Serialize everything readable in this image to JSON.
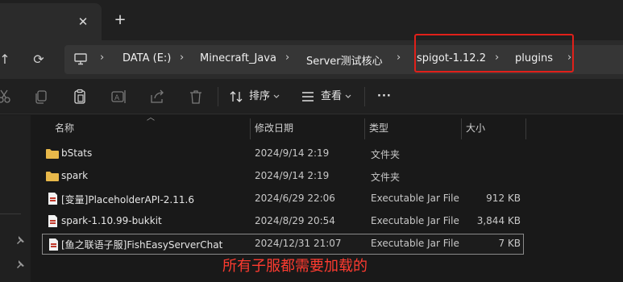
{
  "tabs": {
    "close_glyph": "✕",
    "new_glyph": "+"
  },
  "nav": {
    "up_glyph": "↑",
    "refresh_glyph": "⟳"
  },
  "breadcrumb": {
    "items": [
      "DATA (E:)",
      "Minecraft_Java",
      "Server测试核心",
      "spigot-1.12.2",
      "plugins"
    ],
    "separator": "›"
  },
  "toolbar": {
    "sort_label": "排序",
    "view_label": "查看",
    "more_label": "···",
    "disabled_icon_color": "#7a7a7a"
  },
  "columns": {
    "name": "名称",
    "modified": "修改日期",
    "type": "类型",
    "size": "大小"
  },
  "files": [
    {
      "name": "bStats",
      "modified": "2024/9/14 2:19",
      "type": "文件夹",
      "size": "",
      "kind": "folder"
    },
    {
      "name": "spark",
      "modified": "2024/9/14 2:19",
      "type": "文件夹",
      "size": "",
      "kind": "folder"
    },
    {
      "name": "[变量]PlaceholderAPI-2.11.6",
      "modified": "2024/6/29 22:06",
      "type": "Executable Jar File",
      "size": "912 KB",
      "kind": "jar"
    },
    {
      "name": "spark-1.10.99-bukkit",
      "modified": "2024/8/29 20:54",
      "type": "Executable Jar File",
      "size": "3,844 KB",
      "kind": "jar"
    },
    {
      "name": "[鱼之联语子服]FishEasyServerChat",
      "modified": "2024/12/31 21:07",
      "type": "Executable Jar File",
      "size": "7 KB",
      "kind": "jar"
    }
  ],
  "annotation": "所有子服都需要加载的",
  "colors": {
    "highlight": "#e0201a",
    "annotation": "#ff3b30",
    "folder": "#e8b84a"
  }
}
